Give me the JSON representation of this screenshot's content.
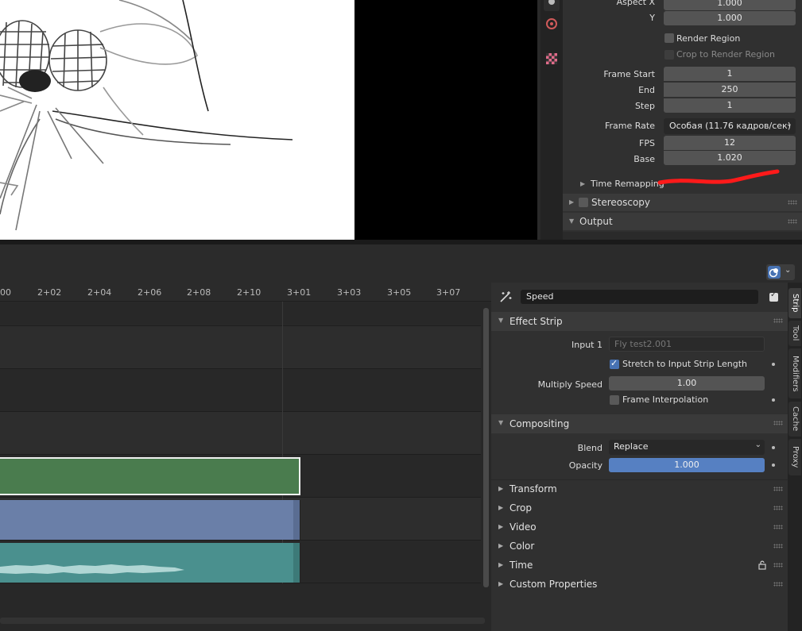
{
  "render_props": {
    "aspect_x_label": "Aspect X",
    "aspect_x": "1.000",
    "aspect_y_label": "Y",
    "aspect_y": "1.000",
    "render_region": "Render Region",
    "crop_region": "Crop to Render Region",
    "frame_start_label": "Frame Start",
    "frame_start": "1",
    "end_label": "End",
    "end": "250",
    "step_label": "Step",
    "step": "1",
    "frame_rate_label": "Frame Rate",
    "frame_rate": "Особая (11.76 кадров/сек)",
    "fps_label": "FPS",
    "fps": "12",
    "base_label": "Base",
    "base": "1.020",
    "time_remapping": "Time Remapping",
    "stereoscopy": "Stereoscopy",
    "output": "Output"
  },
  "timeline": {
    "ticks": [
      "00",
      "2+02",
      "2+04",
      "2+06",
      "2+08",
      "2+10",
      "3+01",
      "3+03",
      "3+05",
      "3+07"
    ]
  },
  "strip_panel": {
    "name": "Speed",
    "effect_strip": "Effect Strip",
    "input1_label": "Input 1",
    "input1": "Fly test2.001",
    "stretch": "Stretch to Input Strip Length",
    "multiply_label": "Multiply Speed",
    "multiply": "1.00",
    "frame_interp": "Frame Interpolation",
    "compositing": "Compositing",
    "blend_label": "Blend",
    "blend": "Replace",
    "opacity_label": "Opacity",
    "opacity": "1.000",
    "collapsed": [
      "Transform",
      "Crop",
      "Video",
      "Color",
      "Time",
      "Custom Properties"
    ]
  },
  "side_tabs": [
    "Strip",
    "Tool",
    "Modifiers",
    "Cache",
    "Proxy"
  ],
  "colors": {
    "accent": "#4772b3",
    "strip_green": "#4a7c4e",
    "strip_blue": "#6a7fa8",
    "strip_teal": "#4a908e",
    "annotation_red": "#ff1a1a"
  },
  "opacity_fill": 1.0
}
